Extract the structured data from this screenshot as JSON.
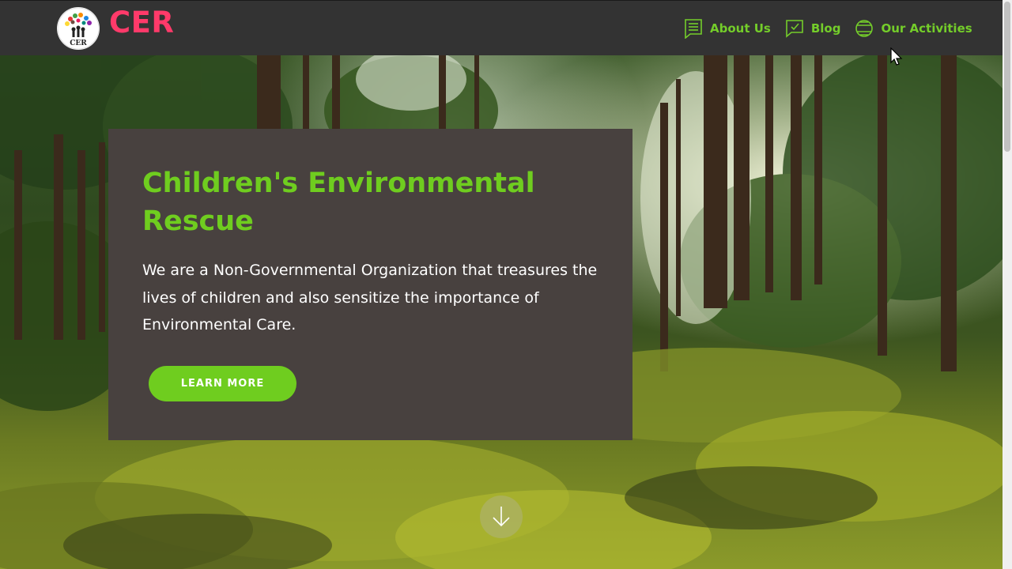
{
  "header": {
    "brand": "CER",
    "logo_text": "CER",
    "nav": [
      {
        "label": "About Us",
        "icon": "document-icon"
      },
      {
        "label": "Blog",
        "icon": "chat-check-icon"
      },
      {
        "label": "Our Activities",
        "icon": "globe-icon"
      }
    ]
  },
  "hero": {
    "title": "Children's Environmental Rescue",
    "description": "We are a Non-Governmental Organization that treasures the lives of children and also sensitize the importance of Environmental Care.",
    "cta_label": "LEARN MORE",
    "scroll_icon": "arrow-down-icon"
  },
  "colors": {
    "accent_green": "#6fcd1f",
    "brand_pink": "#ff3a6a",
    "header_bg": "#333333",
    "card_bg": "#48413f"
  }
}
